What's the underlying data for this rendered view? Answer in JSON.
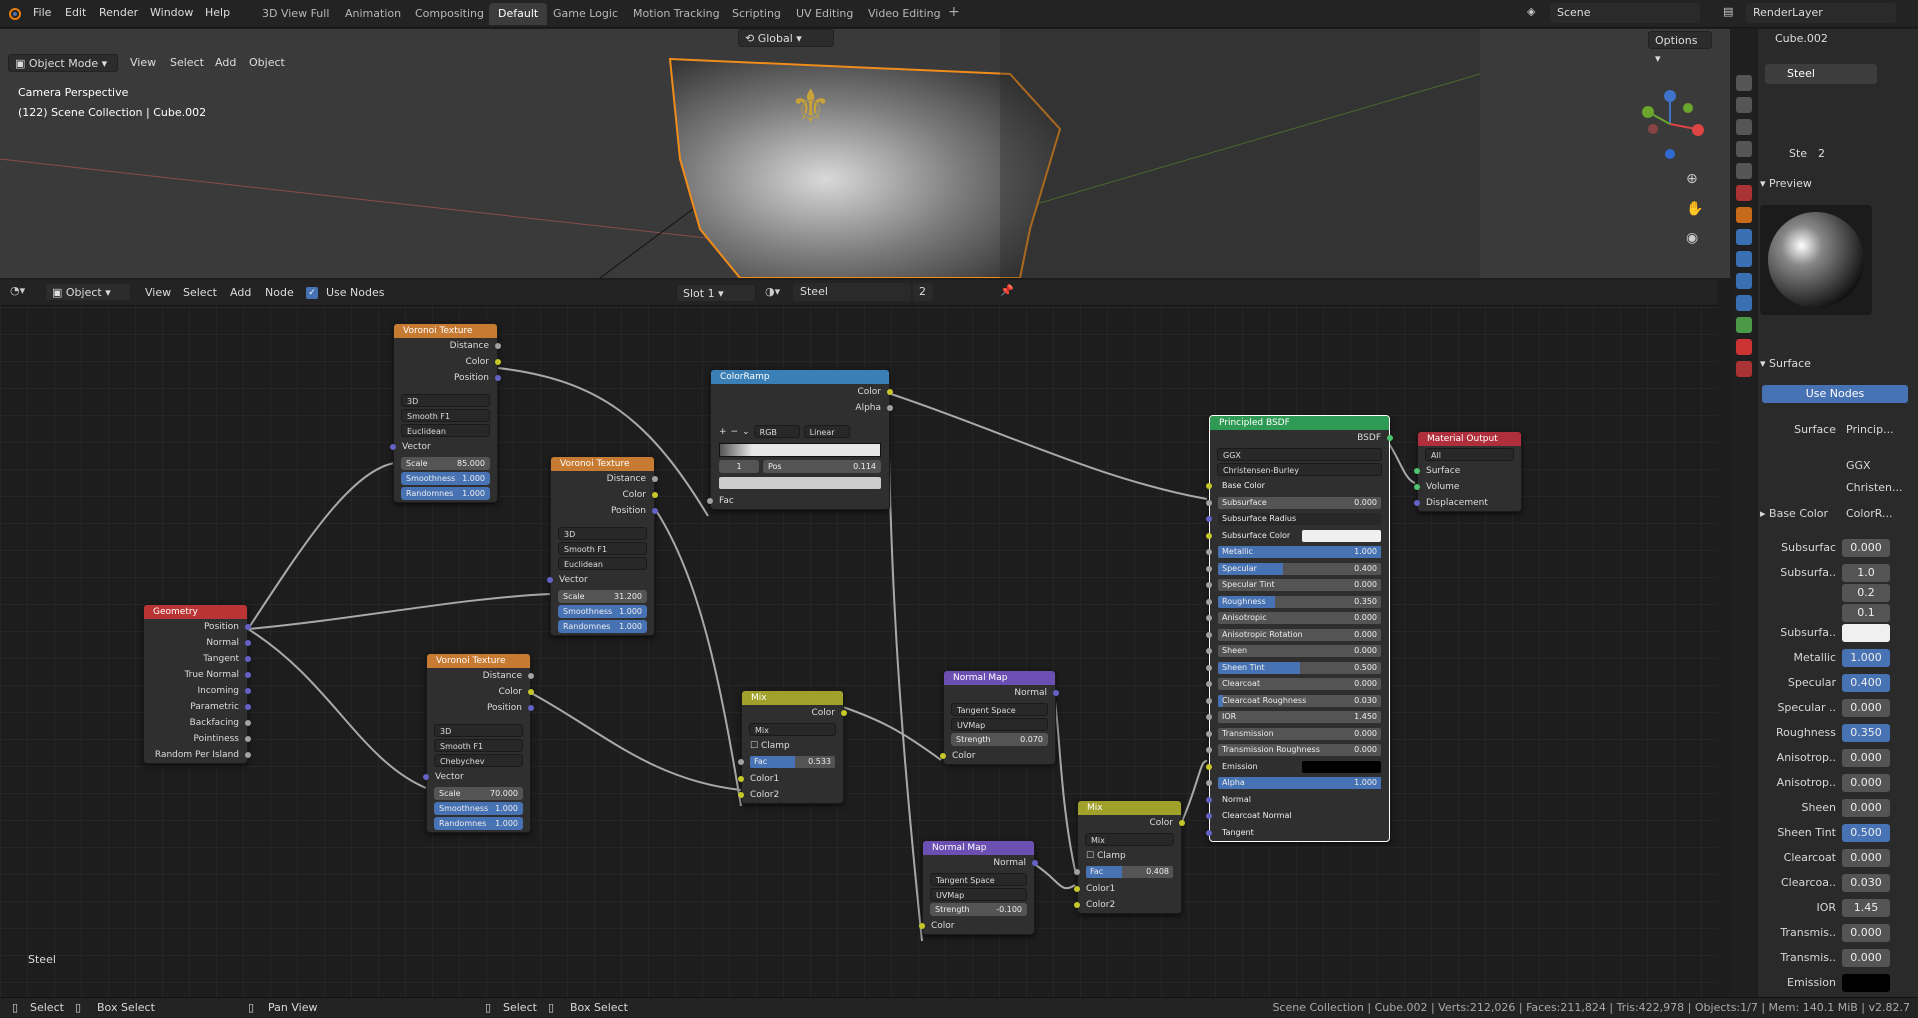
{
  "top_menu": [
    "File",
    "Edit",
    "Render",
    "Window",
    "Help"
  ],
  "workspaces": [
    "3D View Full",
    "Animation",
    "Compositing",
    "Default",
    "Game Logic",
    "Motion Tracking",
    "Scripting",
    "UV Editing",
    "Video Editing"
  ],
  "active_workspace": "Default",
  "scene": "Scene",
  "render_layer": "RenderLayer",
  "viewport": {
    "mode": "Object Mode",
    "menus": [
      "View",
      "Select",
      "Add",
      "Object"
    ],
    "transform": "Global",
    "options": "Options",
    "info_line1": "Camera Perspective",
    "info_line2": "(122) Scene Collection | Cube.002"
  },
  "node_header": {
    "editor": "Object",
    "menus": [
      "View",
      "Select",
      "Add",
      "Node"
    ],
    "use_nodes": "Use Nodes",
    "slot": "Slot 1",
    "material": "Steel",
    "users": "2"
  },
  "nodes": {
    "voronoi1": {
      "title": "Voronoi Texture",
      "outs": [
        "Distance",
        "Color",
        "Position"
      ],
      "sel": [
        "3D",
        "Smooth F1",
        "Euclidean"
      ],
      "vector": "Vector",
      "scale": [
        "Scale",
        "85.000"
      ],
      "smooth": [
        "Smoothness",
        "1.000"
      ],
      "rand": [
        "Randomnes",
        "1.000"
      ]
    },
    "voronoi2": {
      "title": "Voronoi Texture",
      "outs": [
        "Distance",
        "Color",
        "Position"
      ],
      "sel": [
        "3D",
        "Smooth F1",
        "Euclidean"
      ],
      "vector": "Vector",
      "scale": [
        "Scale",
        "31.200"
      ],
      "smooth": [
        "Smoothness",
        "1.000"
      ],
      "rand": [
        "Randomnes",
        "1.000"
      ]
    },
    "voronoi3": {
      "title": "Voronoi Texture",
      "outs": [
        "Distance",
        "Color",
        "Position"
      ],
      "sel": [
        "3D",
        "Smooth F1",
        "Chebychev"
      ],
      "vector": "Vector",
      "scale": [
        "Scale",
        "70.000"
      ],
      "smooth": [
        "Smoothness",
        "1.000"
      ],
      "rand": [
        "Randomnes",
        "1.000"
      ]
    },
    "geometry": {
      "title": "Geometry",
      "outs": [
        "Position",
        "Normal",
        "Tangent",
        "True Normal",
        "Incoming",
        "Parametric",
        "Backfacing",
        "Pointiness",
        "Random Per Island"
      ]
    },
    "colorramp": {
      "title": "ColorRamp",
      "outs": [
        "Color",
        "Alpha"
      ],
      "mode": "RGB",
      "interp": "Linear",
      "index": "1",
      "pos_label": "Pos",
      "pos": "0.114",
      "fac": "Fac"
    },
    "mix1": {
      "title": "Mix",
      "out": "Color",
      "blend": "Mix",
      "clamp": "Clamp",
      "fac": [
        "Fac",
        "0.533"
      ],
      "ins": [
        "Color1",
        "Color2"
      ]
    },
    "mix2": {
      "title": "Mix",
      "out": "Color",
      "blend": "Mix",
      "clamp": "Clamp",
      "fac": [
        "Fac",
        "0.408"
      ],
      "ins": [
        "Color1",
        "Color2"
      ]
    },
    "nmap1": {
      "title": "Normal Map",
      "out": "Normal",
      "space": "Tangent Space",
      "uv": "UVMap",
      "strength": [
        "Strength",
        "0.070"
      ],
      "in": "Color"
    },
    "nmap2": {
      "title": "Normal Map",
      "out": "Normal",
      "space": "Tangent Space",
      "uv": "UVMap",
      "strength": [
        "Strength",
        "-0.100"
      ],
      "in": "Color"
    },
    "bsdf": {
      "title": "Principled BSDF",
      "out": "BSDF",
      "dist": "GGX",
      "sss": "Christensen-Burley",
      "props": [
        [
          "Base Color",
          "",
          0,
          "sock"
        ],
        [
          "Subsurface",
          "0.000",
          0,
          "bar"
        ],
        [
          "Subsurface Radius",
          "",
          0,
          "sel"
        ],
        [
          "Subsurface Color",
          "",
          0,
          "white"
        ],
        [
          "Metallic",
          "1.000",
          1,
          "bar"
        ],
        [
          "Specular",
          "0.400",
          0.4,
          "bar"
        ],
        [
          "Specular Tint",
          "0.000",
          0,
          "bar"
        ],
        [
          "Roughness",
          "0.350",
          0.35,
          "bar"
        ],
        [
          "Anisotropic",
          "0.000",
          0,
          "bar"
        ],
        [
          "Anisotropic Rotation",
          "0.000",
          0,
          "bar"
        ],
        [
          "Sheen",
          "0.000",
          0,
          "bar"
        ],
        [
          "Sheen Tint",
          "0.500",
          0.5,
          "bar"
        ],
        [
          "Clearcoat",
          "0.000",
          0,
          "bar"
        ],
        [
          "Clearcoat Roughness",
          "0.030",
          0.03,
          "bar"
        ],
        [
          "IOR",
          "1.450",
          0,
          "bar"
        ],
        [
          "Transmission",
          "0.000",
          0,
          "bar"
        ],
        [
          "Transmission Roughness",
          "0.000",
          0,
          "bar"
        ],
        [
          "Emission",
          "",
          0,
          "black"
        ],
        [
          "Alpha",
          "1.000",
          1,
          "bar"
        ],
        [
          "Normal",
          "",
          0,
          "sock"
        ],
        [
          "Clearcoat Normal",
          "",
          0,
          "sock"
        ],
        [
          "Tangent",
          "",
          0,
          "sock"
        ]
      ]
    },
    "output": {
      "title": "Material Output",
      "target": "All",
      "ins": [
        "Surface",
        "Volume",
        "Displacement"
      ]
    }
  },
  "frame_label": "Steel",
  "properties": {
    "object": "Cube.002",
    "material_slot": "Steel",
    "material_name": "Ste",
    "material_users": "2",
    "preview": "Preview",
    "surface": "Surface",
    "use_nodes": "Use Nodes",
    "surface_label": "Surface",
    "surface_val": "Princip...",
    "dist": "GGX",
    "sss": "Christen...",
    "base_color": "Base Color",
    "base_color_val": "ColorR...",
    "rows": [
      [
        "Subsurfac",
        "0.000",
        0
      ],
      [
        "Subsurfa..",
        "1.0",
        0
      ],
      [
        "",
        "0.2",
        0
      ],
      [
        "",
        "0.1",
        0
      ],
      [
        "Subsurfa..",
        "",
        2
      ],
      [
        "Metallic",
        "1.000",
        1
      ],
      [
        "Specular",
        "0.400",
        1
      ],
      [
        "Specular ..",
        "0.000",
        0
      ],
      [
        "Roughness",
        "0.350",
        1
      ],
      [
        "Anisotrop..",
        "0.000",
        0
      ],
      [
        "Anisotrop..",
        "0.000",
        0
      ],
      [
        "Sheen",
        "0.000",
        0
      ],
      [
        "Sheen Tint",
        "0.500",
        1
      ],
      [
        "Clearcoat",
        "0.000",
        0
      ],
      [
        "Clearcoa..",
        "0.030",
        0
      ],
      [
        "IOR",
        "1.45",
        0
      ],
      [
        "Transmis..",
        "0.000",
        0
      ],
      [
        "Transmis..",
        "0.000",
        0
      ],
      [
        "Emission",
        "",
        3
      ]
    ]
  },
  "status": {
    "left": [
      "Select",
      "Box Select",
      "Pan View"
    ],
    "mid": [
      "Select",
      "Box Select"
    ],
    "info": "Scene Collection | Cube.002 | Verts:212,026 | Faces:211,824 | Tris:422,978 | Objects:1/7 | Mem: 140.1 MiB | v2.82.7"
  }
}
